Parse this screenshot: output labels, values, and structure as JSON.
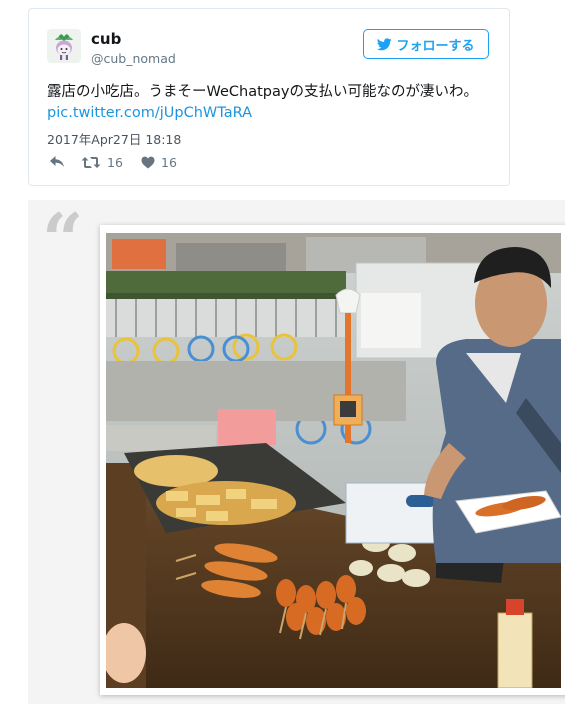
{
  "tweet": {
    "author_name": "cub",
    "author_handle": "@cub_nomad",
    "follow_label": "フォローする",
    "text": "露店の小吃店。うまそーWeChatpayの支払い可能なのが凄いわ。",
    "link": "pic.twitter.com/jUpChWTaRA",
    "date": "2017年Apr27日 18:18",
    "retweet_count": "16",
    "like_count": "16"
  },
  "icons": {
    "avatar": "turnip-avatar-icon",
    "follow": "twitter-bird-icon",
    "reply": "reply-icon",
    "retweet": "retweet-icon",
    "like": "heart-icon",
    "quote": "quote-mark-icon"
  },
  "colors": {
    "accent": "#1da1f2",
    "link": "#1b95e0",
    "text": "#14171a",
    "muted": "#657786",
    "quote_bg": "#f4f4f4"
  },
  "quote": {
    "mark": "“"
  }
}
